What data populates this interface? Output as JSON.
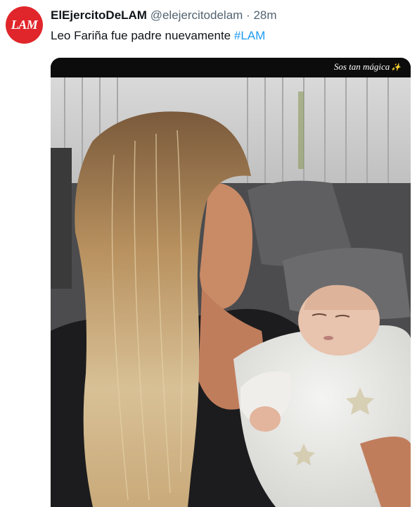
{
  "tweet": {
    "avatar_text": "LAM",
    "display_name": "ElEjercitoDeLAM",
    "handle": "@elejercitodelam",
    "separator": "·",
    "time": "28m",
    "text": "Leo Fariña fue padre nuevamente",
    "hashtag": "#LAM",
    "hashtag_color": "#1d9bf0",
    "avatar_color": "#e0262b"
  },
  "media": {
    "story_caption": "Sos tan mágica",
    "sparkle_icon": "sparkle-icon"
  }
}
